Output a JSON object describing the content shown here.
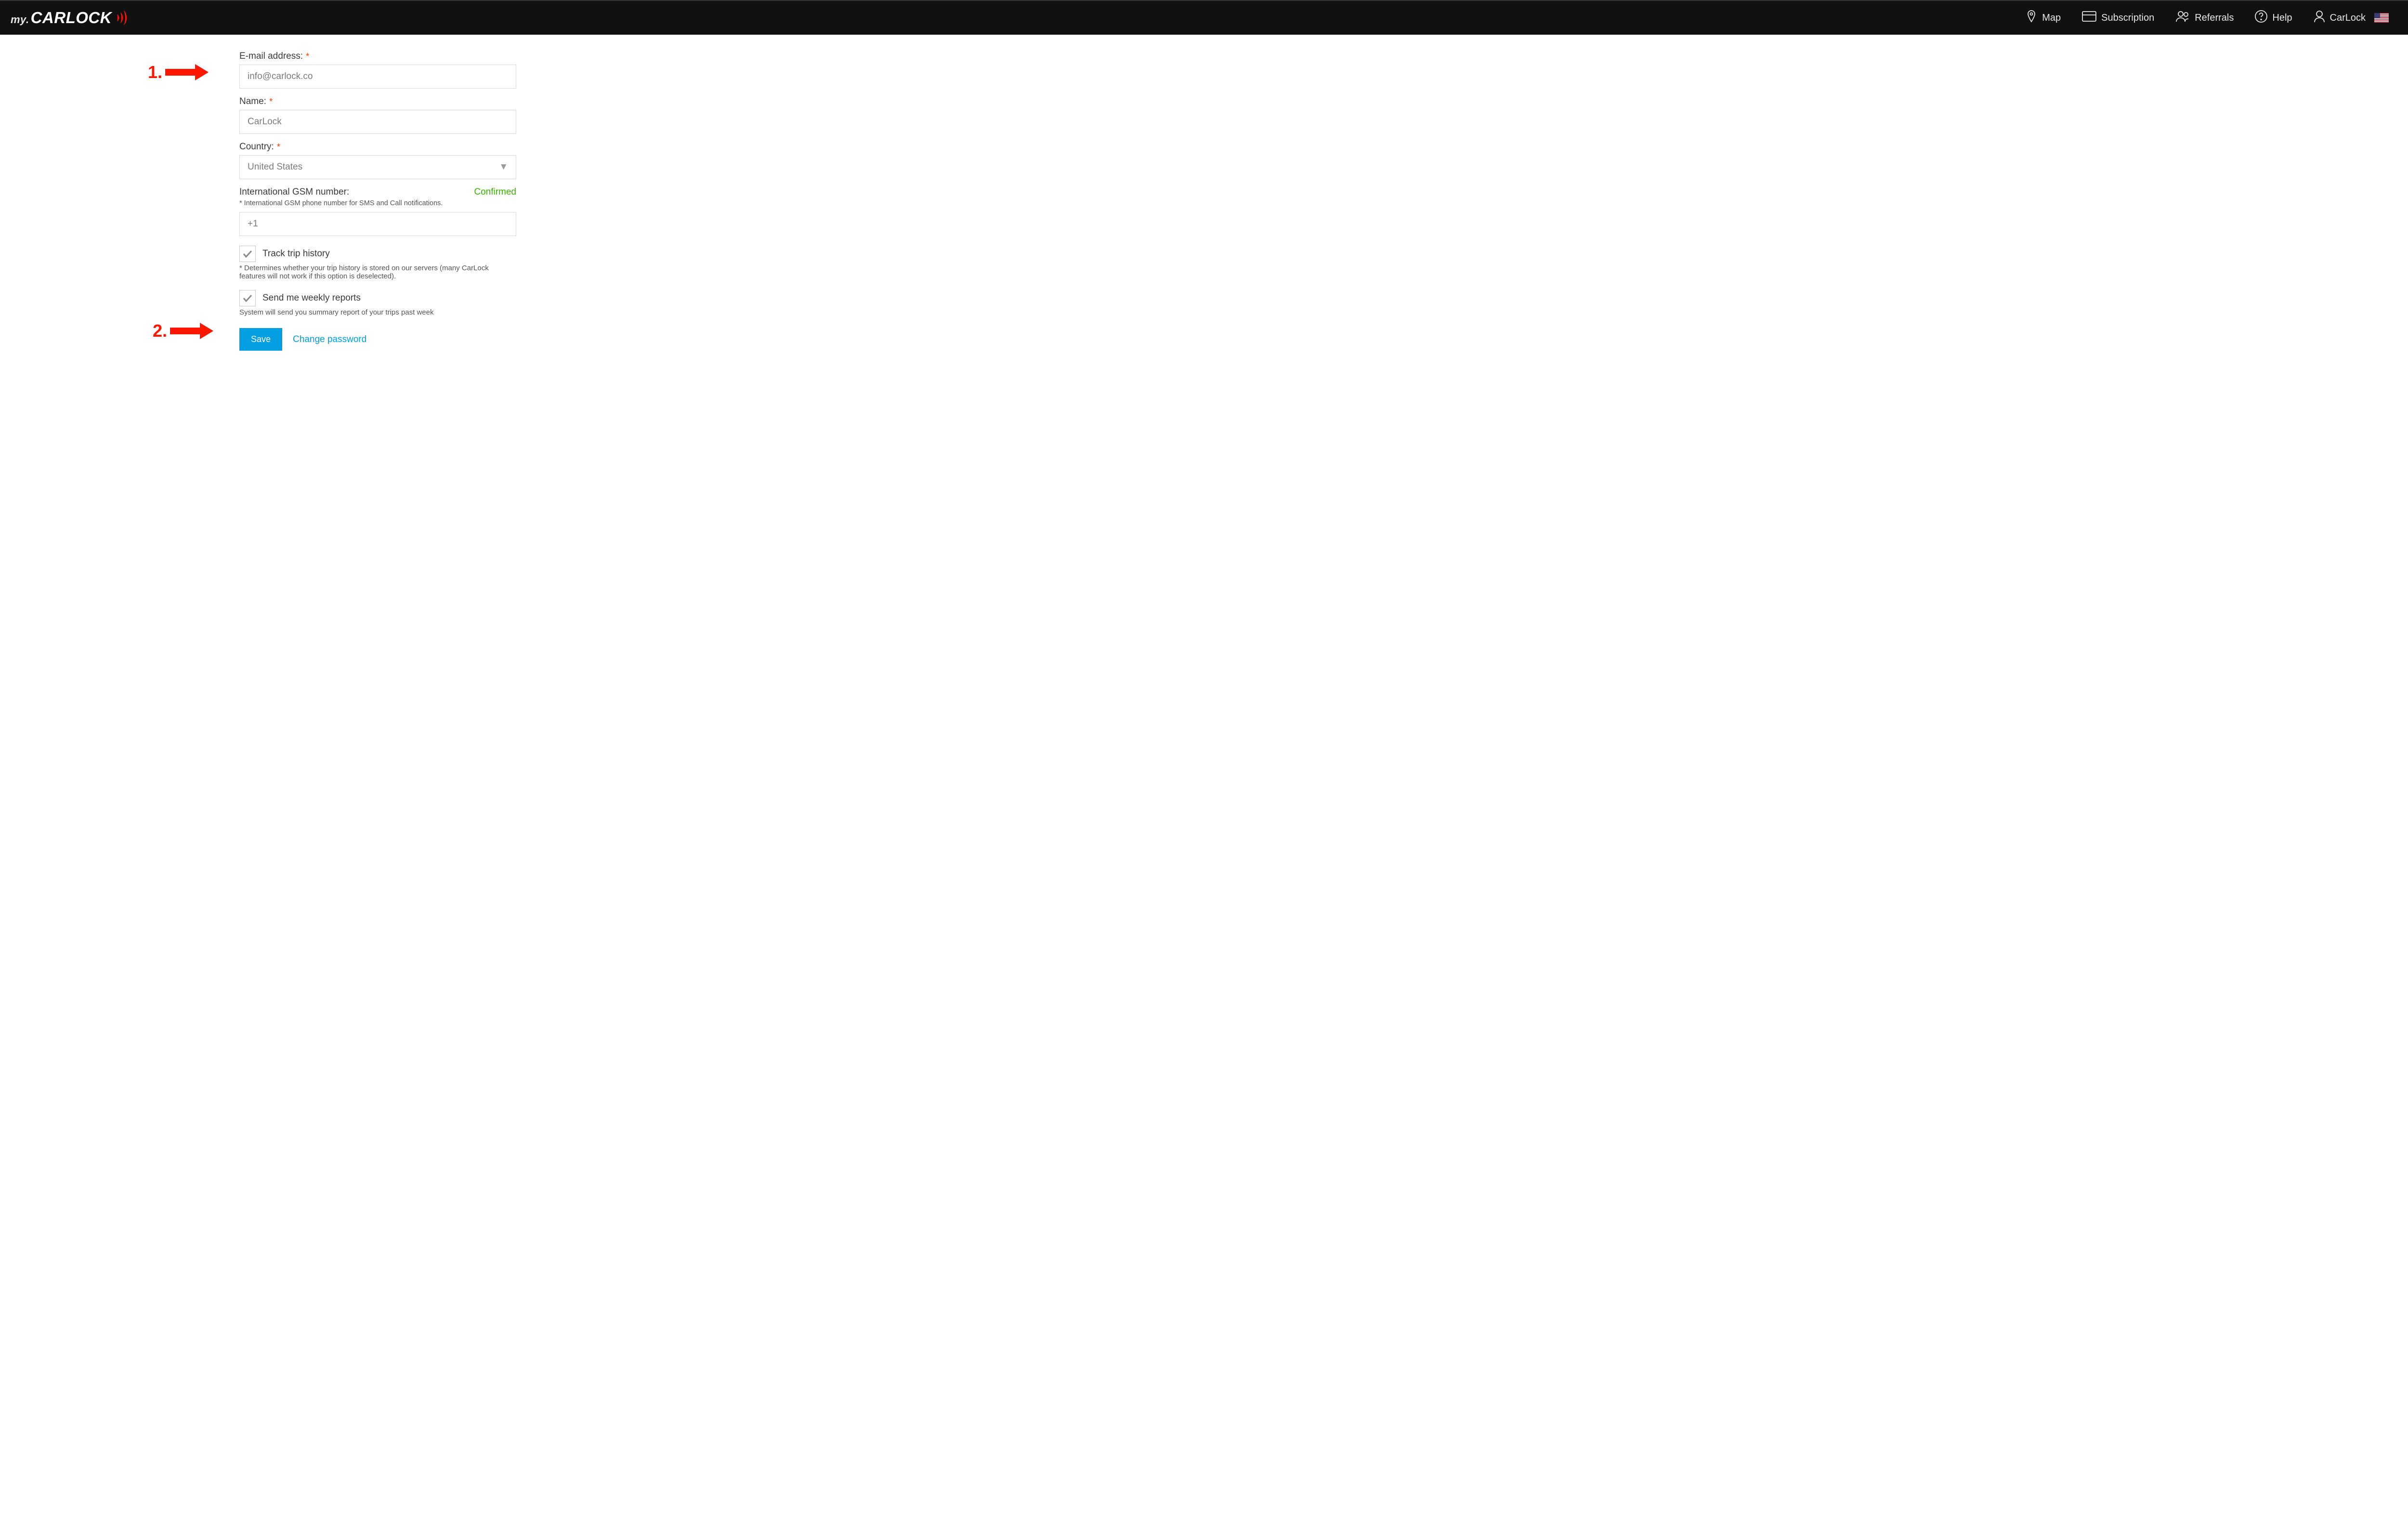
{
  "logo": {
    "prefix": "my.",
    "brand": "CARLOCK"
  },
  "nav": {
    "map": "Map",
    "subscription": "Subscription",
    "referrals": "Referrals",
    "help": "Help",
    "account": "CarLock"
  },
  "form": {
    "email_label": "E-mail address:",
    "email_value": "info@carlock.co",
    "name_label": "Name:",
    "name_value": "CarLock",
    "country_label": "Country:",
    "country_value": "United States",
    "gsm_label": "International GSM number:",
    "gsm_status": "Confirmed",
    "gsm_help": "* International GSM phone number for SMS and Call notifications.",
    "gsm_value": "+1",
    "track_label": "Track trip history",
    "track_help": "* Determines whether your trip history is stored on our servers (many CarLock features will not work if this option is deselected).",
    "weekly_label": "Send me weekly reports",
    "weekly_help": "System will send you summary report of your trips past week",
    "save_label": "Save",
    "change_pw_label": "Change password"
  },
  "annotations": {
    "step1": "1.",
    "step2": "2."
  }
}
